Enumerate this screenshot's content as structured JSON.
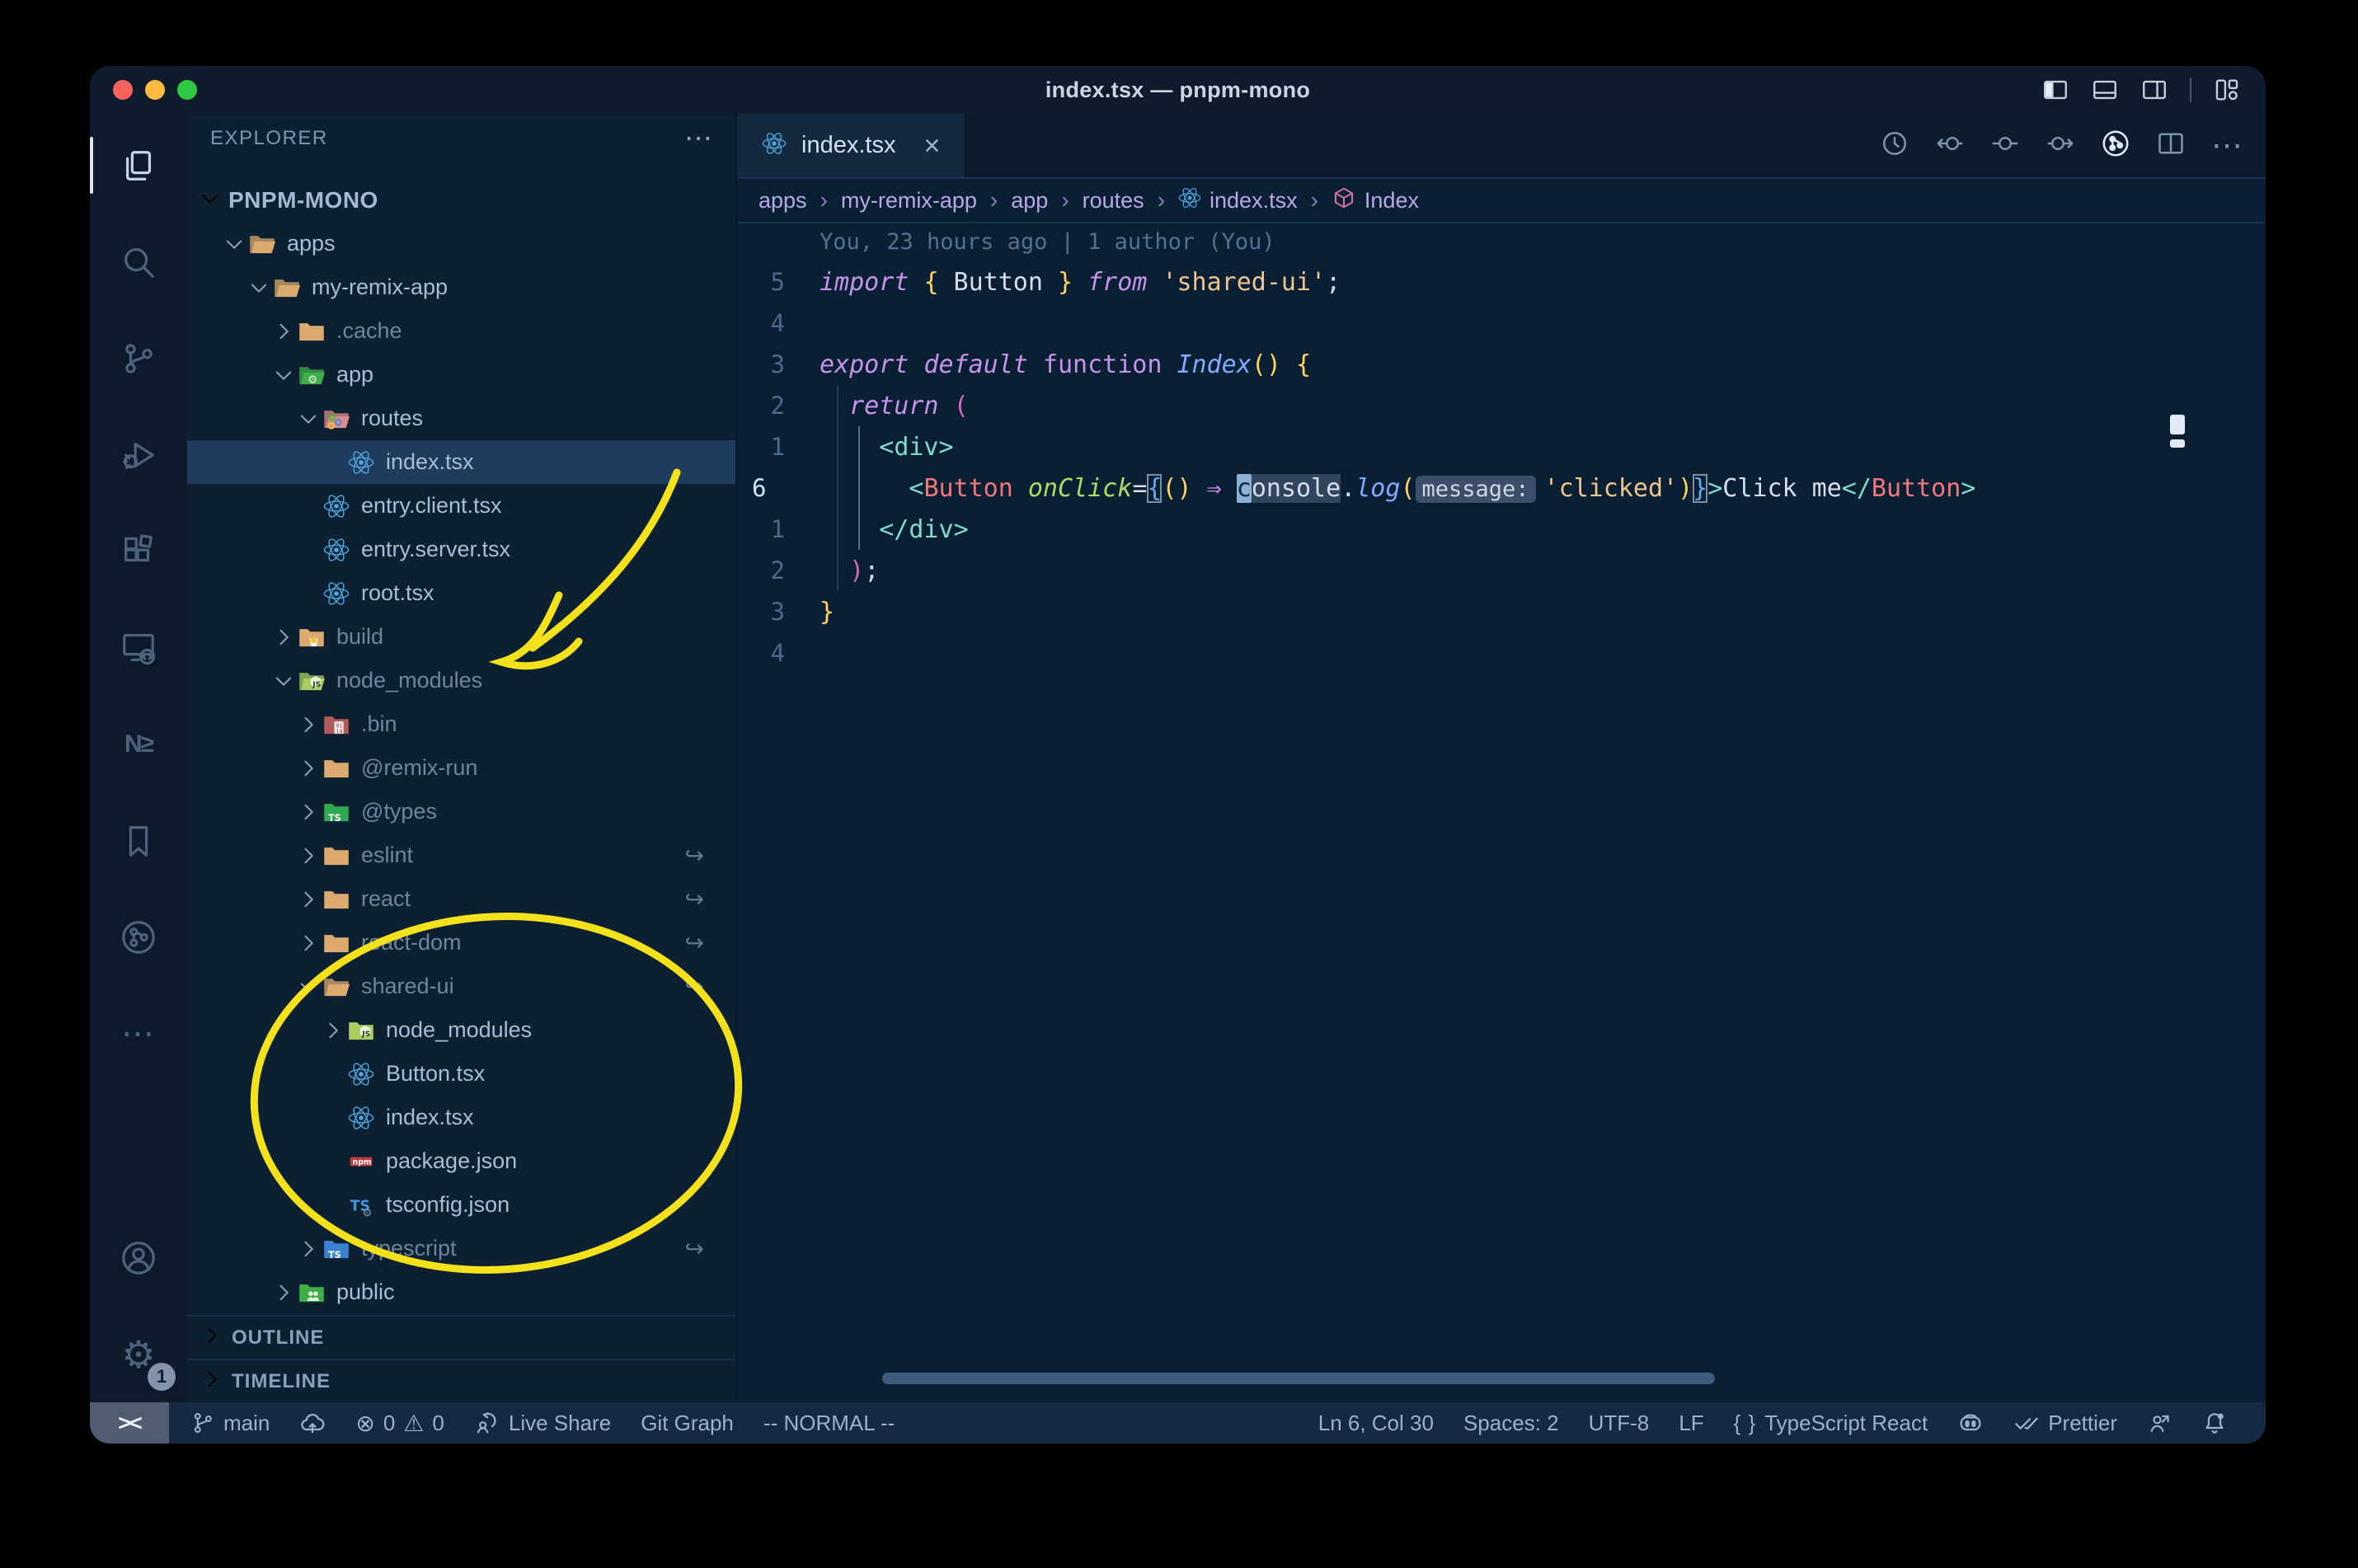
{
  "window": {
    "title": "index.tsx — pnpm-mono"
  },
  "palette": {
    "titlebar-bg": "#0d1b2c",
    "activity-bg": "#0c1a2b",
    "sidebar-bg": "#0d2032",
    "editor-bg": "#0a1f33",
    "status-bg": "#152a42",
    "kw": "#c792ea",
    "fn": "#82aaff",
    "attr": "#addb67",
    "comp": "#f0787a",
    "tag": "#7fdbca",
    "str": "#ecc48d",
    "brace": "#ffd35c",
    "pnk": "#d767bd",
    "txt": "#d6deeb",
    "annotation-yellow": "#f2e11c",
    "traffic-close": "#f9615b",
    "traffic-min": "#fcbb40",
    "traffic-zoom": "#2fc841"
  },
  "titlebar": {
    "traffic_lights": [
      "close",
      "minimize",
      "zoom"
    ],
    "layout_icons": [
      "layout-sidebar-left",
      "layout-panel",
      "layout-sidebar-right",
      "layout-customize"
    ]
  },
  "activity_bar": {
    "top": [
      {
        "name": "explorer",
        "active": true
      },
      {
        "name": "search",
        "active": false
      },
      {
        "name": "source-control",
        "active": false
      },
      {
        "name": "run-debug",
        "active": false
      },
      {
        "name": "extensions",
        "active": false
      },
      {
        "name": "remote-explorer",
        "active": false
      },
      {
        "name": "nx-console",
        "active": false
      },
      {
        "name": "bookmarks",
        "active": false
      },
      {
        "name": "git-graph",
        "active": false
      },
      {
        "name": "more-views",
        "active": false
      }
    ],
    "bottom": [
      {
        "name": "accounts"
      },
      {
        "name": "settings",
        "badge": "1"
      }
    ]
  },
  "sidebar": {
    "header": "EXPLORER",
    "header_more": "⋯",
    "project": "PNPM-MONO",
    "tree": [
      {
        "label": "apps",
        "depth": 1,
        "icon": "folder-open-tan",
        "chev": "open",
        "dim": false
      },
      {
        "label": "my-remix-app",
        "depth": 2,
        "icon": "folder-open-tan",
        "chev": "open",
        "dim": false
      },
      {
        "label": ".cache",
        "depth": 3,
        "icon": "folder-tan",
        "chev": "closed",
        "dim": true
      },
      {
        "label": "app",
        "depth": 3,
        "icon": "folder-app",
        "chev": "open",
        "dim": false
      },
      {
        "label": "routes",
        "depth": 4,
        "icon": "folder-routes",
        "chev": "open",
        "dim": false
      },
      {
        "label": "index.tsx",
        "depth": 5,
        "icon": "react",
        "file": true,
        "selected": true,
        "dim": false
      },
      {
        "label": "entry.client.tsx",
        "depth": 4,
        "icon": "react",
        "file": true,
        "dim": false
      },
      {
        "label": "entry.server.tsx",
        "depth": 4,
        "icon": "react",
        "file": true,
        "dim": false
      },
      {
        "label": "root.tsx",
        "depth": 4,
        "icon": "react",
        "file": true,
        "dim": false
      },
      {
        "label": "build",
        "depth": 3,
        "icon": "folder-build",
        "chev": "closed",
        "dim": true
      },
      {
        "label": "node_modules",
        "depth": 3,
        "icon": "folder-nm-open",
        "chev": "open",
        "dim": true
      },
      {
        "label": ".bin",
        "depth": 4,
        "icon": "folder-bin",
        "chev": "closed",
        "dim": true
      },
      {
        "label": "@remix-run",
        "depth": 4,
        "icon": "folder-tan",
        "chev": "closed",
        "dim": true
      },
      {
        "label": "@types",
        "depth": 4,
        "icon": "folder-types",
        "chev": "closed",
        "dim": true
      },
      {
        "label": "eslint",
        "depth": 4,
        "icon": "folder-tan",
        "chev": "closed",
        "dim": true,
        "symlink": true
      },
      {
        "label": "react",
        "depth": 4,
        "icon": "folder-tan",
        "chev": "closed",
        "dim": true,
        "symlink": true
      },
      {
        "label": "react-dom",
        "depth": 4,
        "icon": "folder-tan",
        "chev": "closed",
        "dim": true,
        "symlink": true
      },
      {
        "label": "shared-ui",
        "depth": 4,
        "icon": "folder-open-tan",
        "chev": "open",
        "dim": true,
        "symlink": true
      },
      {
        "label": "node_modules",
        "depth": 5,
        "icon": "folder-nm",
        "chev": "closed",
        "dim": false
      },
      {
        "label": "Button.tsx",
        "depth": 5,
        "icon": "react",
        "file": true,
        "dim": false
      },
      {
        "label": "index.tsx",
        "depth": 5,
        "icon": "react",
        "file": true,
        "dim": false
      },
      {
        "label": "package.json",
        "depth": 5,
        "icon": "npm",
        "file": true,
        "dim": false
      },
      {
        "label": "tsconfig.json",
        "depth": 5,
        "icon": "tsconfig",
        "file": true,
        "dim": false
      },
      {
        "label": "typescript",
        "depth": 4,
        "icon": "folder-ts",
        "chev": "closed",
        "dim": true,
        "symlink": true
      },
      {
        "label": "public",
        "depth": 3,
        "icon": "folder-public",
        "chev": "closed",
        "dim": false
      }
    ],
    "sections": [
      {
        "label": "OUTLINE"
      },
      {
        "label": "TIMELINE"
      }
    ]
  },
  "editor": {
    "tab": {
      "label": "index.tsx",
      "icon": "react",
      "close": "×"
    },
    "actions": [
      "file-history",
      "prev-change",
      "change",
      "next-change",
      "git-graph-bright",
      "split-editor",
      "more-actions"
    ],
    "breadcrumbs": [
      {
        "label": "apps"
      },
      {
        "label": "my-remix-app"
      },
      {
        "label": "app"
      },
      {
        "label": "routes"
      },
      {
        "label": "index.tsx",
        "icon": "react"
      },
      {
        "label": "Index",
        "icon": "symbol-box"
      }
    ],
    "code": {
      "lines": [
        {
          "num": "",
          "blame": true,
          "tokens": [
            [
              "You, 23 hours ago | 1 author (You)",
              "blame"
            ]
          ]
        },
        {
          "num": "5",
          "tokens": [
            [
              "import ",
              "kw"
            ],
            [
              "{",
              "brace"
            ],
            [
              " Button ",
              "txt"
            ],
            [
              "}",
              "brace"
            ],
            [
              " ",
              "txt"
            ],
            [
              "from",
              "kw"
            ],
            [
              " ",
              "txt"
            ],
            [
              "'shared-ui'",
              "str"
            ],
            [
              ";",
              "txt"
            ]
          ]
        },
        {
          "num": "4",
          "tokens": []
        },
        {
          "num": "3",
          "tokens": [
            [
              "export",
              "kw"
            ],
            [
              " ",
              "txt"
            ],
            [
              "default",
              "kw"
            ],
            [
              " ",
              "txt"
            ],
            [
              "function",
              "kwu"
            ],
            [
              " ",
              "txt"
            ],
            [
              "Index",
              "fn"
            ],
            [
              "()",
              "brace"
            ],
            [
              " ",
              "txt"
            ],
            [
              "{",
              "brace"
            ]
          ]
        },
        {
          "num": "2",
          "tokens": [
            [
              "  ",
              "txt"
            ],
            [
              "return",
              "kw"
            ],
            [
              " ",
              "txt"
            ],
            [
              "(",
              "pnk"
            ]
          ]
        },
        {
          "num": "1",
          "tokens": [
            [
              "    ",
              "txt"
            ],
            [
              "<",
              "tag"
            ],
            [
              "div",
              "tag"
            ],
            [
              ">",
              "tag"
            ]
          ]
        },
        {
          "num": "6",
          "current": true,
          "tokens": [
            [
              "      ",
              "txt"
            ],
            [
              "<",
              "tag"
            ],
            [
              "Button",
              "comp"
            ],
            [
              " ",
              "txt"
            ],
            [
              "onClick",
              "attr"
            ],
            [
              "=",
              "txt"
            ],
            [
              "{",
              "brkt"
            ],
            [
              "()",
              "brace"
            ],
            [
              " ",
              "txt"
            ],
            [
              "⇒",
              "kw"
            ],
            [
              " ",
              "txt"
            ],
            [
              "c",
              "cursor"
            ],
            [
              "onsole",
              "occur"
            ],
            [
              ".",
              "txt"
            ],
            [
              "log",
              "fn"
            ],
            [
              "(",
              "brace"
            ],
            [
              "message:",
              "inlay"
            ],
            [
              "'clicked'",
              "str"
            ],
            [
              ")",
              "brace"
            ],
            [
              "}",
              "brkt"
            ],
            [
              ">",
              "tag"
            ],
            [
              "Click me",
              "txt"
            ],
            [
              "</",
              "tag"
            ],
            [
              "Button",
              "comp"
            ],
            [
              ">",
              "tag"
            ]
          ]
        },
        {
          "num": "1",
          "tokens": [
            [
              "    ",
              "txt"
            ],
            [
              "</",
              "tag"
            ],
            [
              "div",
              "tag"
            ],
            [
              ">",
              "tag"
            ]
          ]
        },
        {
          "num": "2",
          "tokens": [
            [
              "  ",
              "txt"
            ],
            [
              ")",
              "pnk"
            ],
            [
              ";",
              "txt"
            ]
          ]
        },
        {
          "num": "3",
          "tokens": [
            [
              "}",
              "brace"
            ]
          ]
        },
        {
          "num": "4",
          "tokens": []
        }
      ]
    }
  },
  "status_bar": {
    "remote": "><",
    "left": [
      {
        "name": "git-branch",
        "icon": "branch",
        "label": "main"
      },
      {
        "name": "sync-changes",
        "icon": "cloud-upload",
        "label": ""
      },
      {
        "name": "problems",
        "icon": "problems",
        "label": "0",
        "label2": "0"
      },
      {
        "name": "live-share",
        "icon": "live-share",
        "label": "Live Share"
      },
      {
        "name": "git-graph",
        "icon": "",
        "label": "Git Graph"
      },
      {
        "name": "vim-mode",
        "icon": "",
        "label": "-- NORMAL --"
      }
    ],
    "right": [
      {
        "name": "cursor-position",
        "icon": "",
        "label": "Ln 6, Col 30"
      },
      {
        "name": "indentation",
        "icon": "",
        "label": "Spaces: 2"
      },
      {
        "name": "encoding",
        "icon": "",
        "label": "UTF-8"
      },
      {
        "name": "eol",
        "icon": "",
        "label": "LF"
      },
      {
        "name": "language-mode",
        "icon": "brackets",
        "label": "TypeScript React"
      },
      {
        "name": "copilot",
        "icon": "copilot",
        "label": ""
      },
      {
        "name": "prettier",
        "icon": "double-check",
        "label": "Prettier"
      },
      {
        "name": "feedback",
        "icon": "person-arrow",
        "label": ""
      },
      {
        "name": "notifications",
        "icon": "bell",
        "label": ""
      }
    ]
  },
  "annotations": {
    "color": "#f2e11c",
    "shapes": [
      "hand-drawn-arrow-to-node-modules",
      "hand-drawn-ellipse-around-shared-ui"
    ]
  }
}
